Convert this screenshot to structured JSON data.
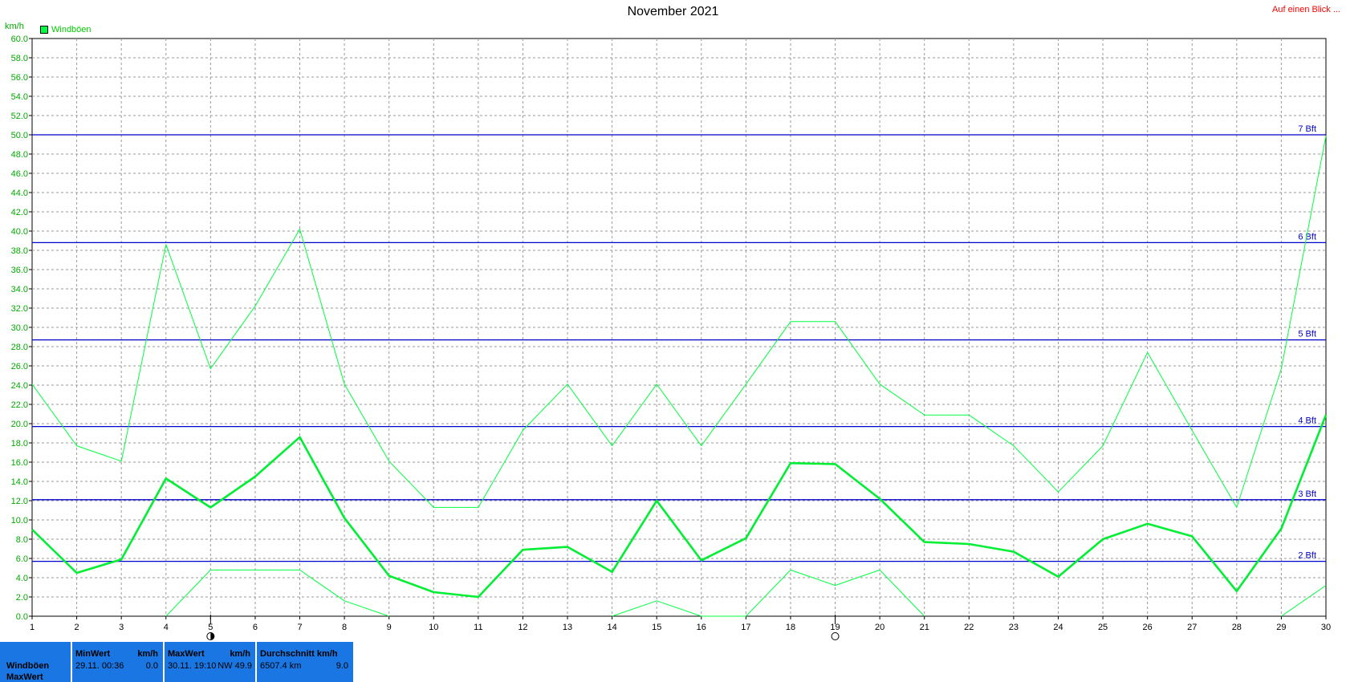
{
  "header": {
    "title": "November 2021",
    "quick_link": "Auf einen Blick ...",
    "unit": "km/h",
    "legend_label": "Windböen"
  },
  "chart_data": {
    "type": "line",
    "title": "November 2021",
    "ylabel": "km/h",
    "xlabel": "",
    "x": [
      1,
      2,
      3,
      4,
      5,
      6,
      7,
      8,
      9,
      10,
      11,
      12,
      13,
      14,
      15,
      16,
      17,
      18,
      19,
      20,
      21,
      22,
      23,
      24,
      25,
      26,
      27,
      28,
      29,
      30
    ],
    "ylim": [
      0,
      60
    ],
    "ytick_step": 2,
    "grid": true,
    "legend_placement": "top-left",
    "series": [
      {
        "name": "Windböen",
        "role": "average",
        "color": "#00ee33",
        "values": [
          9.0,
          4.5,
          5.9,
          14.3,
          11.3,
          14.5,
          18.6,
          10.2,
          4.2,
          2.5,
          2.0,
          6.9,
          7.2,
          4.6,
          12.0,
          5.8,
          8.1,
          15.9,
          15.8,
          12.2,
          7.7,
          7.5,
          6.7,
          4.1,
          8.0,
          9.6,
          8.3,
          2.6,
          9.1,
          20.9
        ]
      },
      {
        "role": "max",
        "color": "#00ff40",
        "values": [
          24.1,
          17.7,
          16.1,
          38.6,
          25.7,
          32.2,
          40.2,
          24.1,
          16.1,
          11.3,
          11.3,
          19.3,
          24.1,
          17.7,
          24.1,
          17.7,
          24.1,
          30.6,
          30.6,
          24.1,
          20.9,
          20.9,
          17.7,
          12.9,
          17.7,
          27.4,
          19.3,
          11.3,
          25.7,
          49.9
        ]
      },
      {
        "role": "min",
        "color": "#00ff40",
        "values": [
          null,
          null,
          null,
          0.0,
          4.8,
          4.8,
          4.8,
          1.6,
          0.0,
          null,
          null,
          null,
          null,
          0.0,
          1.6,
          0.0,
          0.0,
          4.8,
          3.2,
          4.8,
          0.0,
          null,
          null,
          null,
          null,
          null,
          null,
          null,
          0.0,
          3.2
        ]
      }
    ],
    "reference_lines": [
      {
        "label": "2 Bft",
        "value": 5.7
      },
      {
        "label": "3 Bft",
        "value": 12.1
      },
      {
        "label": "4 Bft",
        "value": 19.7
      },
      {
        "label": "5 Bft",
        "value": 28.7
      },
      {
        "label": "6 Bft",
        "value": 38.8
      },
      {
        "label": "7 Bft",
        "value": 50.0
      }
    ],
    "moon_phases": [
      {
        "day": 5,
        "phase": "half-moon-icon"
      },
      {
        "day": 19,
        "phase": "full-moon-icon"
      }
    ],
    "colors": {
      "reference_line": "#0000cc",
      "stats_bar": "#1a76e2"
    }
  },
  "stats": {
    "row_names": [
      "Windböen",
      "MaxWert"
    ],
    "min": {
      "head": "MinWert",
      "unit": "km/h",
      "date": "29.11.  00:36",
      "value": "0.0"
    },
    "max": {
      "head": "MaxWert",
      "unit": "km/h",
      "date": "30.11.  19:10",
      "dir_value": "NW 49.9"
    },
    "avg": {
      "head": "Durchschnitt km/h",
      "distance": "6507.4 km",
      "value": "9.0"
    }
  }
}
